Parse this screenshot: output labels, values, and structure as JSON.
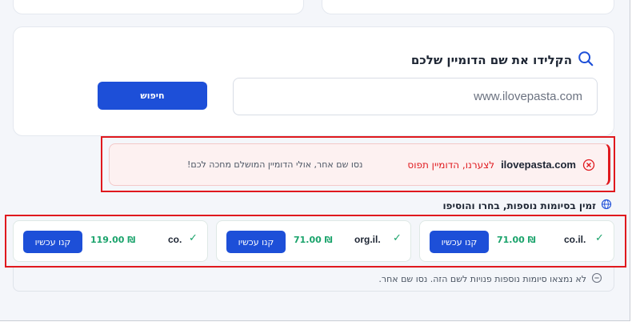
{
  "search": {
    "title": "הקלידו את שם הדומיין שלכם",
    "value": "www.ilovepasta.com",
    "button_label": "חיפוש"
  },
  "alert": {
    "domain": "ilovepasta.com",
    "status": "לצערנו, הדומיין תפוס",
    "hint": "נסו שם אחר, אולי הדומיין המושלם מחכה לכם!"
  },
  "extensions": {
    "title": "זמין בסיומות נוספות, בחרו והוסיפו",
    "items": [
      {
        "ext": "co.il.",
        "price": "71.00 ₪",
        "buy_label": "קנו עכשיו"
      },
      {
        "ext": "org.il.",
        "price": "71.00 ₪",
        "buy_label": "קנו עכשיו"
      },
      {
        "ext": "co.",
        "price": "119.00 ₪",
        "buy_label": "קנו עכשיו"
      }
    ],
    "notice": "לא נמצאו סיומות נוספות פנויות לשם הזה. נסו שם אחר."
  },
  "colors": {
    "primary": "#1d4fd8",
    "error": "#e0191e",
    "success": "#1aa36b",
    "page_bg": "#f4f6fa"
  },
  "icons": [
    "search-icon",
    "error-circle-icon",
    "globe-icon",
    "check-icon",
    "minus-circle-icon"
  ]
}
